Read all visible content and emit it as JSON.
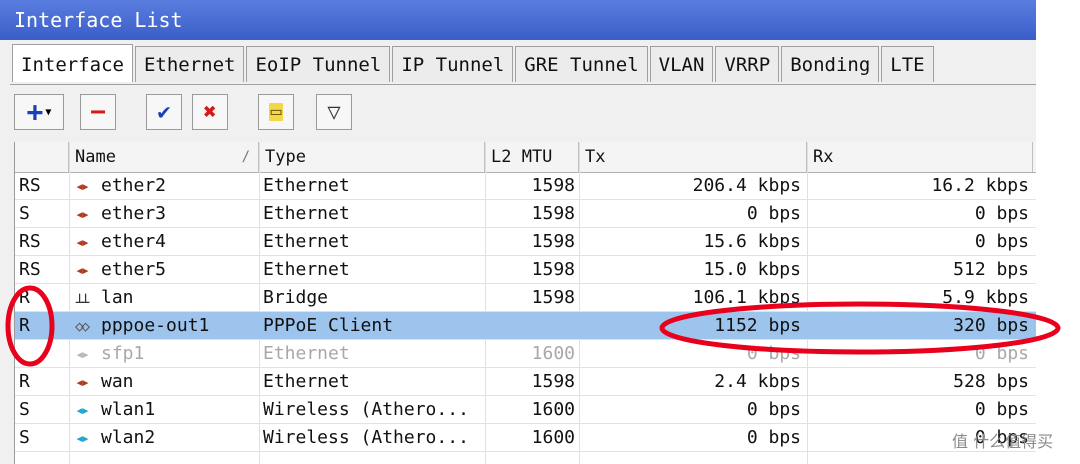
{
  "window": {
    "title": "Interface List"
  },
  "tabs": [
    "Interface",
    "Ethernet",
    "EoIP Tunnel",
    "IP Tunnel",
    "GRE Tunnel",
    "VLAN",
    "VRRP",
    "Bonding",
    "LTE"
  ],
  "toolbar": {
    "add": "+",
    "remove": "−",
    "enable": "✔",
    "disable": "✖",
    "comment": "▭",
    "filter": "▽"
  },
  "columns": {
    "flags": "",
    "name": "Name",
    "sort": "/",
    "type": "Type",
    "l2mtu": "L2 MTU",
    "tx": "Tx",
    "rx": "Rx"
  },
  "rows": [
    {
      "flags": "RS",
      "icon": "◂▸",
      "name": "ether2",
      "type": "Ethernet",
      "l2mtu": "1598",
      "tx": "206.4 kbps",
      "rx": "16.2 kbps"
    },
    {
      "flags": "S",
      "icon": "◂▸",
      "name": "ether3",
      "type": "Ethernet",
      "l2mtu": "1598",
      "tx": "0 bps",
      "rx": "0 bps"
    },
    {
      "flags": "RS",
      "icon": "◂▸",
      "name": "ether4",
      "type": "Ethernet",
      "l2mtu": "1598",
      "tx": "15.6 kbps",
      "rx": "0 bps"
    },
    {
      "flags": "RS",
      "icon": "◂▸",
      "name": "ether5",
      "type": "Ethernet",
      "l2mtu": "1598",
      "tx": "15.0 kbps",
      "rx": "512 bps"
    },
    {
      "flags": "R",
      "icon": "⊥⊥",
      "name": "lan",
      "type": "Bridge",
      "l2mtu": "1598",
      "tx": "106.1 kbps",
      "rx": "5.9 kbps"
    },
    {
      "flags": "R",
      "icon": "◇◇",
      "name": "pppoe-out1",
      "type": "PPPoE Client",
      "l2mtu": "",
      "tx": "1152 bps",
      "rx": "320 bps"
    },
    {
      "flags": "",
      "icon": "◂▸",
      "name": "sfp1",
      "type": "Ethernet",
      "l2mtu": "1600",
      "tx": "0 bps",
      "rx": "0 bps"
    },
    {
      "flags": "R",
      "icon": "◂▸",
      "name": "wan",
      "type": "Ethernet",
      "l2mtu": "1598",
      "tx": "2.4 kbps",
      "rx": "528 bps"
    },
    {
      "flags": "S",
      "icon": "◂▸",
      "name": "wlan1",
      "type": "Wireless (Athero...",
      "l2mtu": "1600",
      "tx": "0 bps",
      "rx": "0 bps"
    },
    {
      "flags": "S",
      "icon": "◂▸",
      "name": "wlan2",
      "type": "Wireless (Athero...",
      "l2mtu": "1600",
      "tx": "0 bps",
      "rx": "0 bps"
    }
  ],
  "watermark": "值 什么值得买",
  "colors": {
    "title": "#3a5ec8",
    "selected": "#9cc4ec",
    "annotation": "#e8001c",
    "iconRed": "#b03a1c",
    "iconBlue": "#18a7d0"
  }
}
